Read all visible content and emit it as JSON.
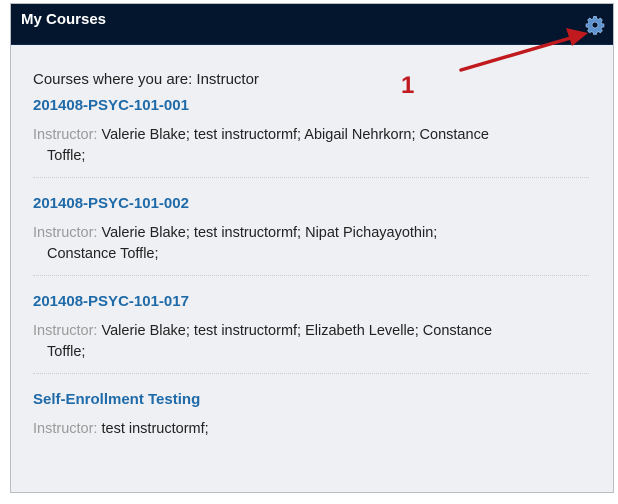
{
  "module": {
    "title": "My Courses",
    "role_heading": "Courses where you are: Instructor",
    "instructor_label": "Instructor:"
  },
  "annotation": {
    "number": "1",
    "color": "#c0191e"
  },
  "courses": [
    {
      "name": "201408-PSYC-101-001",
      "instructors": "Valerie Blake;  test instructormf;  Abigail Nehrkorn;  Constance Toffle;"
    },
    {
      "name": "201408-PSYC-101-002",
      "instructors": "Valerie Blake;  test instructormf;  Nipat Pichayayothin;  Constance Toffle;"
    },
    {
      "name": "201408-PSYC-101-017",
      "instructors": "Valerie Blake;  test instructormf;  Elizabeth Levelle;  Constance Toffle;"
    },
    {
      "name": "Self-Enrollment Testing",
      "instructors": "test instructormf;"
    }
  ],
  "icons": {
    "settings": "gear-icon"
  },
  "colors": {
    "header_bg": "#03162e",
    "link": "#1f6aa8",
    "panel_bg": "#eef0f3"
  }
}
